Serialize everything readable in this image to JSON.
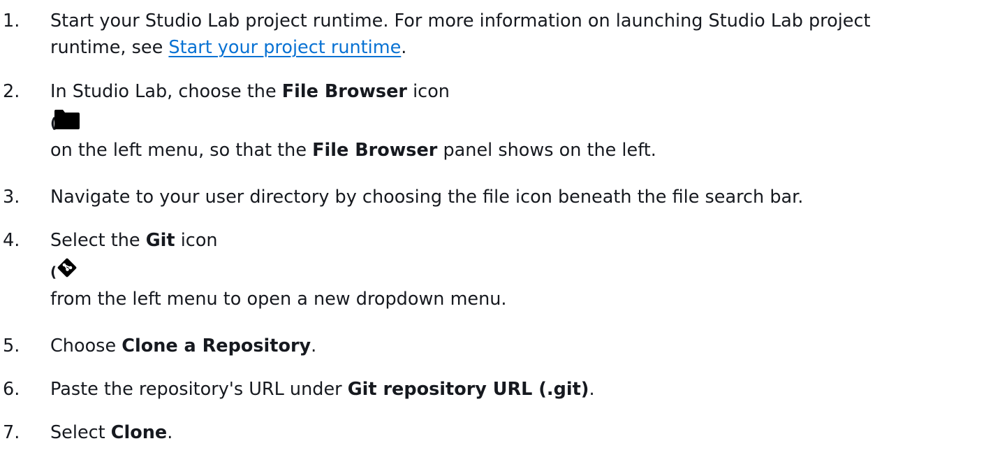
{
  "steps": [
    {
      "number": "1.",
      "text_a": "Start your Studio Lab project runtime. For more information on launching Studio Lab project",
      "text_b": "runtime, see ",
      "link": "Start your project runtime",
      "text_c": "."
    },
    {
      "number": "2.",
      "text_a": "In Studio Lab, choose the ",
      "bold_a": "File Browser",
      "text_b": " icon",
      "paren": "(",
      "icon": "folder-icon",
      "text_c": "on the left menu, so that the ",
      "bold_b": "File Browser",
      "text_d": " panel shows on the left."
    },
    {
      "number": "3.",
      "text_a": "Navigate to your user directory by choosing the file icon beneath the file search bar."
    },
    {
      "number": "4.",
      "text_a": "Select the ",
      "bold_a": "Git",
      "text_b": " icon",
      "paren": "(",
      "icon": "git-icon",
      "text_c": "from the left menu to open a new dropdown menu."
    },
    {
      "number": "5.",
      "text_a": "Choose ",
      "bold_a": "Clone a Repository",
      "text_b": "."
    },
    {
      "number": "6.",
      "text_a": "Paste the repository's URL under ",
      "bold_a": "Git repository URL (.git)",
      "text_b": "."
    },
    {
      "number": "7.",
      "text_a": "Select ",
      "bold_a": "Clone",
      "text_b": "."
    }
  ],
  "colors": {
    "text": "#16191f",
    "link": "#0972d3",
    "background": "#ffffff"
  }
}
